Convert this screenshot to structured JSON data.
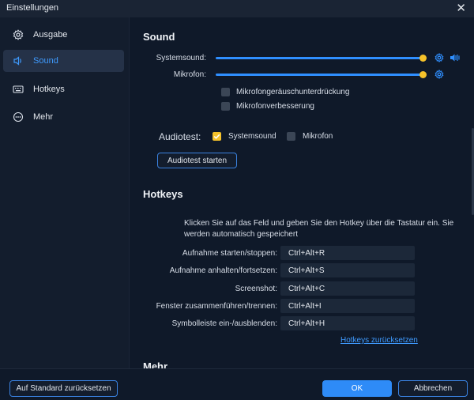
{
  "window": {
    "title": "Einstellungen"
  },
  "sidebar": {
    "items": [
      {
        "label": "Ausgabe",
        "icon": "gear-icon"
      },
      {
        "label": "Sound",
        "icon": "speaker-icon"
      },
      {
        "label": "Hotkeys",
        "icon": "keyboard-icon"
      },
      {
        "label": "Mehr",
        "icon": "more-dots-icon"
      }
    ],
    "active_index": 1
  },
  "sound": {
    "heading": "Sound",
    "system_label": "Systemsound:",
    "mic_label": "Mikrofon:",
    "system_level": 1.0,
    "mic_level": 1.0,
    "noise_suppression_label": "Mikrofongeräuschunterdrückung",
    "mic_enhance_label": "Mikrofonverbesserung",
    "audiotest_label": "Audiotest:",
    "audiotest_system_label": "Systemsound",
    "audiotest_mic_label": "Mikrofon",
    "audiotest_system_checked": true,
    "audiotest_mic_checked": false,
    "start_button": "Audiotest starten"
  },
  "hotkeys": {
    "heading": "Hotkeys",
    "description": "Klicken Sie auf das Feld und geben Sie den Hotkey über die Tastatur ein. Sie werden automatisch gespeichert",
    "rows": [
      {
        "label": "Aufnahme starten/stoppen:",
        "value": "Ctrl+Alt+R"
      },
      {
        "label": "Aufnahme anhalten/fortsetzen:",
        "value": "Ctrl+Alt+S"
      },
      {
        "label": "Screenshot:",
        "value": "Ctrl+Alt+C"
      },
      {
        "label": "Fenster zusammenführen/trennen:",
        "value": "Ctrl+Alt+I"
      },
      {
        "label": "Symbolleiste ein-/ausblenden:",
        "value": "Ctrl+Alt+H"
      }
    ],
    "reset_link": "Hotkeys zurücksetzen"
  },
  "more": {
    "heading": "Mehr"
  },
  "footer": {
    "reset_default": "Auf Standard zurücksetzen",
    "ok": "OK",
    "cancel": "Abbrechen"
  },
  "colors": {
    "accent": "#2e8bf7",
    "checkbox": "#f5c22a",
    "background": "#0f1929"
  }
}
